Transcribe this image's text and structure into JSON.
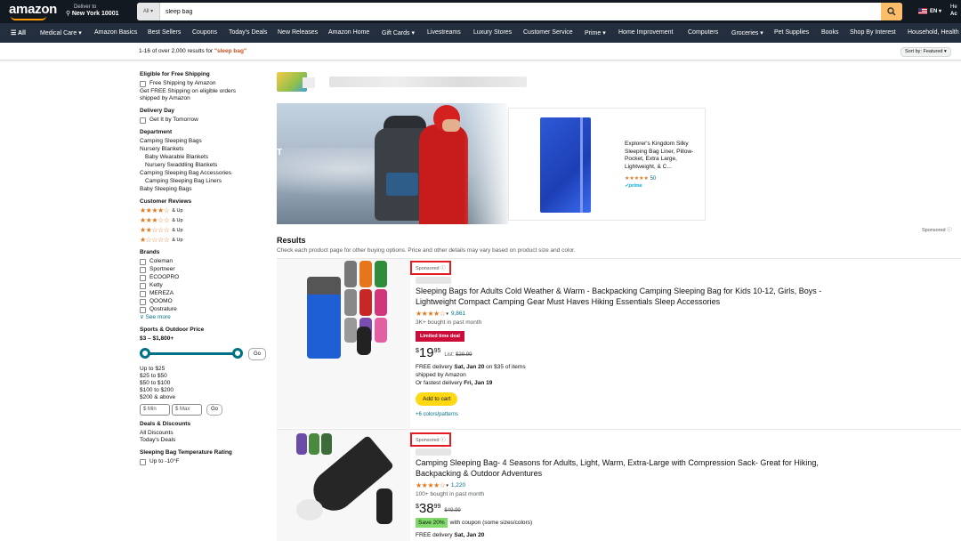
{
  "header": {
    "logo": "amazon",
    "deliver_to": "Deliver to",
    "location": "New York 10001",
    "search_category": "All",
    "search_value": "sleep bag",
    "language": "EN",
    "account_l1": "He",
    "account_l2": "Ac"
  },
  "nav": {
    "items": [
      "All",
      "Medical Care",
      "Amazon Basics",
      "Best Sellers",
      "Coupons",
      "Today's Deals",
      "New Releases",
      "Amazon Home",
      "Gift Cards",
      "Livestreams",
      "Luxury Stores",
      "Customer Service",
      "Prime",
      "Home Improvement",
      "Computers",
      "Groceries",
      "Pet Supplies",
      "Books",
      "Shop By Interest",
      "Household, Health"
    ]
  },
  "results_bar": {
    "count": "1-16 of over 2,000 results for",
    "query": "\"sleep bag\"",
    "sort": "Sort by: Featured"
  },
  "filters": {
    "free_shipping_head": "Eligible for Free Shipping",
    "free_shipping_opt": "Free Shipping by Amazon",
    "free_shipping_note": "Get FREE Shipping on eligible orders shipped by Amazon",
    "delivery_head": "Delivery Day",
    "delivery_opt": "Get It by Tomorrow",
    "department_head": "Department",
    "departments": [
      "Camping Sleeping Bags",
      "Nursery Blankets",
      "Baby Wearable Blankets",
      "Nursery Swaddling Blankets",
      "Camping Sleeping Bag Accessories",
      "Camping Sleeping Bag Liners",
      "Baby Sleeping Bags"
    ],
    "reviews_head": "Customer Reviews",
    "reviews_up": "& Up",
    "brands_head": "Brands",
    "brands": [
      "Coleman",
      "Sportneer",
      "ECOOPRO",
      "Ketty",
      "MEREZA",
      "QOOMO",
      "Qostrature"
    ],
    "see_more": "See more",
    "price_head": "Sports & Outdoor Price",
    "price_range": "$3 – $1,800+",
    "go": "Go",
    "price_options": [
      "Up to $25",
      "$25 to $50",
      "$50 to $100",
      "$100 to $200",
      "$200 & above"
    ],
    "min_placeholder": "$ Min",
    "max_placeholder": "$ Max",
    "deals_head": "Deals & Discounts",
    "deals": [
      "All Discounts",
      "Today's Deals"
    ],
    "temp_head": "Sleeping Bag Temperature Rating",
    "temp_opt": "Up to -10°F"
  },
  "featured": {
    "title": "Explorer's Kingdom Silky Sleeping Bag Liner, Pillow-Pocket, Extra Large, Lightweight, & C...",
    "rating_count": "50",
    "prime": "✓prime",
    "sponsored": "Sponsored"
  },
  "results": {
    "title": "Results",
    "subtitle": "Check each product page for other buying options. Price and other details may vary based on product size and color."
  },
  "products": [
    {
      "sponsored": "Sponsored",
      "title": "Sleeping Bags for Adults Cold Weather & Warm - Backpacking Camping Sleeping Bag for Kids 10-12, Girls, Boys - Lightweight Compact Camping Gear Must Haves Hiking Essentials Sleep Accessories",
      "rating_count": "9,861",
      "bought": "3K+ bought in past month",
      "deal": "Limited time deal",
      "price_whole": "19",
      "price_frac": "95",
      "list_label": "List:",
      "list_price": "$29.99",
      "delivery_1_pre": "FREE delivery",
      "delivery_1_date": "Sat, Jan 20",
      "delivery_1_post": "on $35 of items",
      "delivery_2": "shipped by Amazon",
      "delivery_3_pre": "Or fastest delivery",
      "delivery_3_date": "Fri, Jan 19",
      "cart": "Add to cart",
      "colors": "+6 colors/patterns"
    },
    {
      "sponsored": "Sponsored",
      "title": "Camping Sleeping Bag- 4 Seasons for Adults, Light, Warm, Extra-Large with Compression Sack- Great for Hiking, Backpacking & Outdoor Adventures",
      "rating_count": "1,220",
      "bought": "100+ bought in past month",
      "price_whole": "38",
      "price_frac": "99",
      "list_price": "$49.99",
      "coupon_badge": "Save 20%",
      "coupon_text": "with coupon (some sizes/colors)",
      "delivery_1_pre": "FREE delivery",
      "delivery_1_date": "Sat, Jan 20"
    }
  ],
  "colors": {
    "header": "#131921",
    "nav": "#232f3e",
    "accent": "#ff9900",
    "link": "#007185",
    "star": "#de7921",
    "deal": "#cc0c39",
    "cart": "#ffd814",
    "sponsored_box": "#e51b23"
  }
}
